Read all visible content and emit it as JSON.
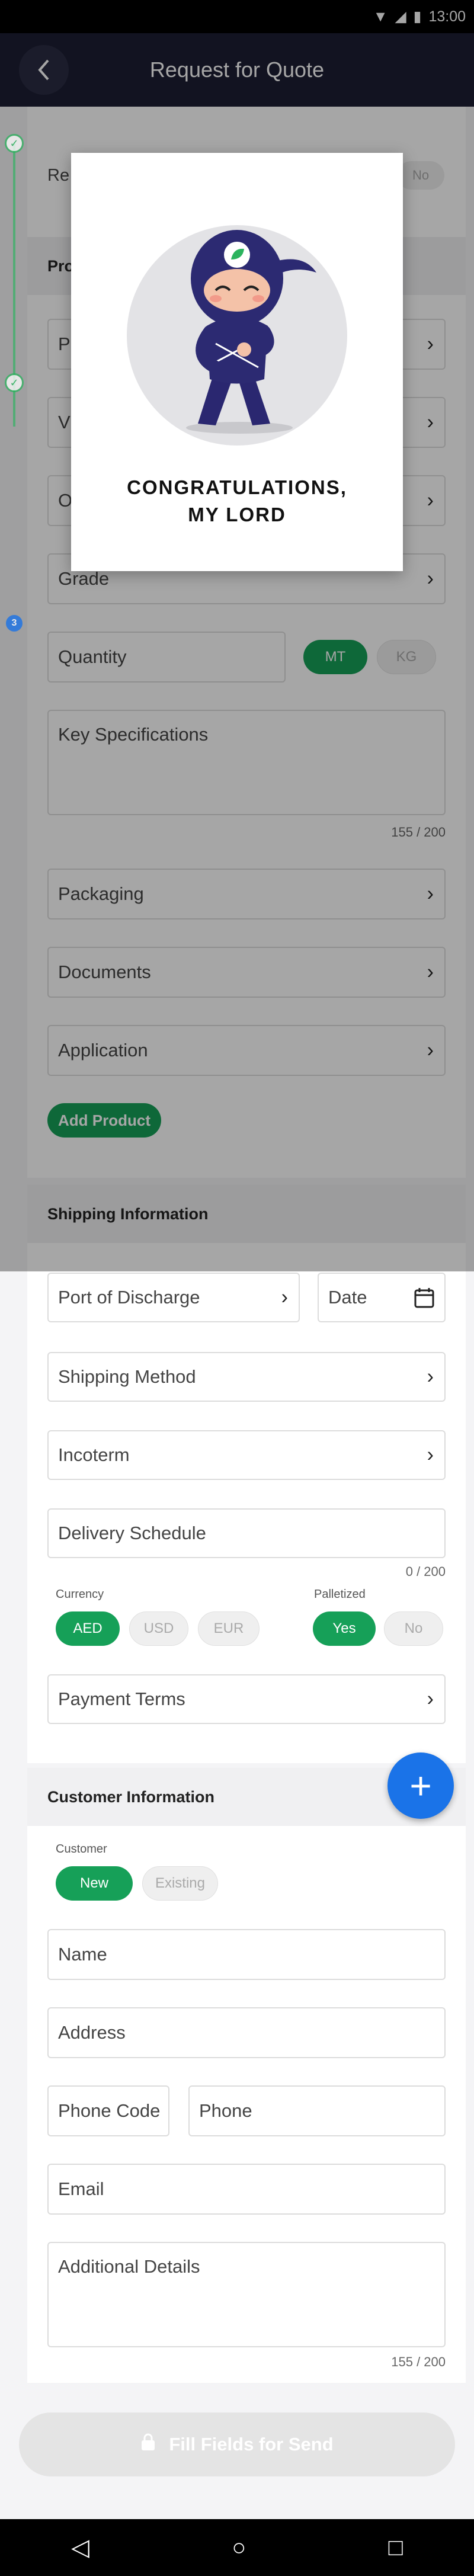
{
  "status_bar": {
    "time": "13:00"
  },
  "app_bar": {
    "title": "Request for Quote"
  },
  "stepper": {
    "current_step": "3"
  },
  "background_partial": {
    "request_prefix": "Re",
    "toggle_no": "No",
    "product_prefix": "Pro",
    "row_prefix_1": "P",
    "row_prefix_2": "V",
    "row_prefix_3": "O"
  },
  "product": {
    "grade": "Grade",
    "quantity_placeholder": "Quantity",
    "unit_mt": "MT",
    "unit_kg": "KG",
    "key_specs_placeholder": "Key Specifications",
    "key_specs_counter": "155 / 200",
    "packaging": "Packaging",
    "documents": "Documents",
    "application": "Application",
    "add_product": "Add Product"
  },
  "shipping": {
    "header": "Shipping Information",
    "port_of_discharge": "Port of Discharge",
    "date_placeholder": "Date",
    "shipping_method": "Shipping Method",
    "incoterm": "Incoterm",
    "delivery_schedule": "Delivery Schedule",
    "delivery_counter": "0 / 200",
    "currency_label": "Currency",
    "currencies": [
      "AED",
      "USD",
      "EUR"
    ],
    "palletized_label": "Palletized",
    "yes": "Yes",
    "no": "No",
    "payment_terms": "Payment Terms"
  },
  "customer": {
    "header": "Customer Information",
    "customer_label": "Customer",
    "new": "New",
    "existing": "Existing",
    "name": "Name",
    "address": "Address",
    "phone_code": "Phone Code",
    "phone": "Phone",
    "email": "Email",
    "additional_details": "Additional Details",
    "additional_counter": "155 / 200"
  },
  "send_button": "Fill Fields for Send",
  "modal": {
    "line1": "CONGRATULATIONS,",
    "line2": "MY LORD"
  },
  "colors": {
    "accent_green": "#16a058",
    "fab_blue": "#1a73e8",
    "app_bar": "#1d1e33"
  }
}
